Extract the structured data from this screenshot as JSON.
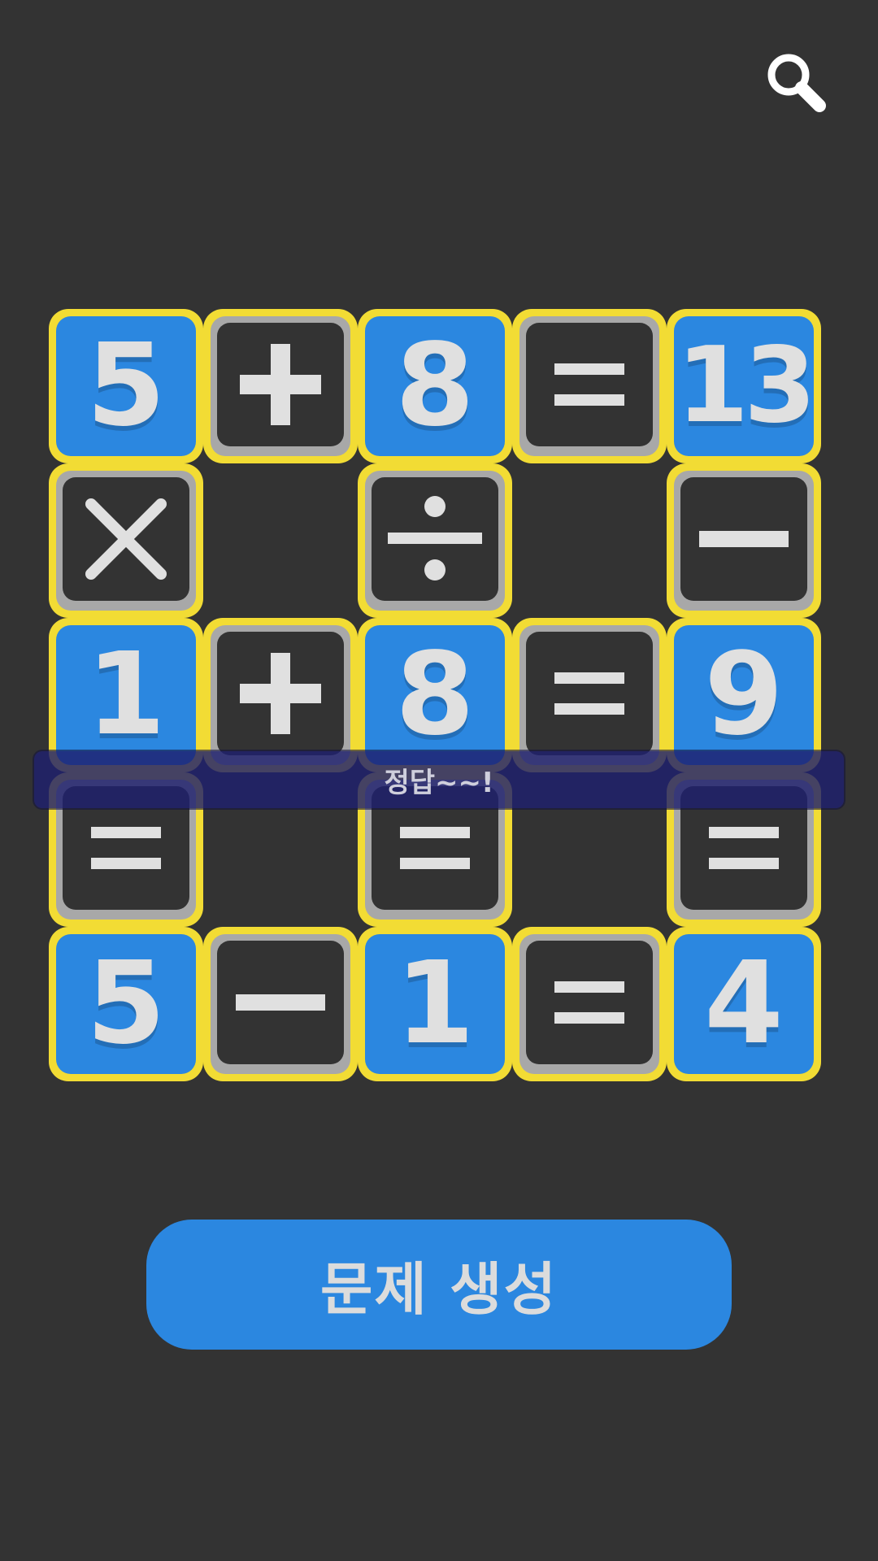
{
  "header": {
    "search_icon": "magnifier-icon"
  },
  "puzzle": {
    "rows": [
      [
        "5",
        "+",
        "8",
        "=",
        "13"
      ],
      [
        "×",
        "",
        "÷",
        "",
        "−"
      ],
      [
        "1",
        "+",
        "8",
        "=",
        "9"
      ],
      [
        "=",
        "",
        "=",
        "",
        "="
      ],
      [
        "5",
        "−",
        "1",
        "=",
        "4"
      ]
    ]
  },
  "feedback": {
    "message": "정답~~!"
  },
  "actions": {
    "generate_label": "문제 생성"
  },
  "colors": {
    "background": "#333333",
    "number_tile": "#2b87e0",
    "tile_border": "#f2dc34",
    "operator_ring": "#a8a8a8",
    "glyph": "#e0e0e0",
    "banner": "#1e206e"
  }
}
